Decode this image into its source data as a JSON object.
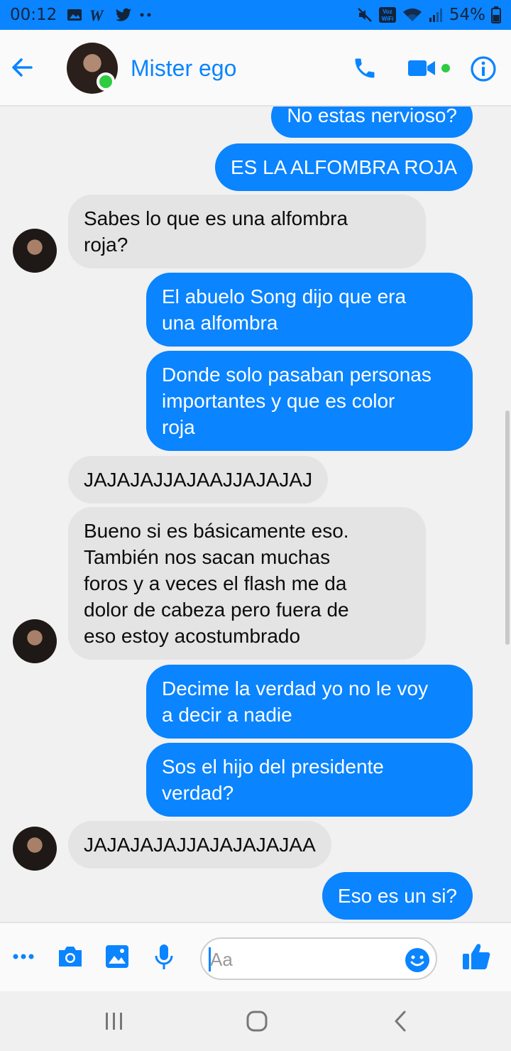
{
  "status_bar": {
    "time": "00:12",
    "battery": "54%",
    "left_icons": [
      "gallery-icon",
      "w-icon",
      "twitter-icon",
      "more-dots-icon"
    ],
    "right_icons": [
      "mute-icon",
      "voz-wifi-icon",
      "wifi-icon",
      "signal-icon",
      "battery-icon"
    ]
  },
  "header": {
    "contact_name": "Mister ego",
    "online": true,
    "accent": "#0a84ff"
  },
  "messages": [
    {
      "side": "out",
      "text": "No estas nervioso?"
    },
    {
      "side": "out",
      "text": "ES LA ALFOMBRA ROJA"
    },
    {
      "side": "in",
      "text": "Sabes lo que es una alfombra\nroja?"
    },
    {
      "side": "out",
      "text": "El abuelo Song dijo que era\nuna alfombra"
    },
    {
      "side": "out",
      "text": "Donde solo pasaban personas\nimportantes y que es color\nroja"
    },
    {
      "side": "in",
      "text": "JAJAJAJJAJAAJJAJAJAJ"
    },
    {
      "side": "in",
      "text": "Bueno si es básicamente eso.\nTambién nos sacan muchas\nforos y a veces el flash me da\ndolor de cabeza pero fuera de\neso estoy acostumbrado"
    },
    {
      "side": "out",
      "text": "Decime la verdad yo no le voy\na decir a nadie"
    },
    {
      "side": "out",
      "text": "Sos el hijo del presidente\nverdad?"
    },
    {
      "side": "in",
      "text": "JAJAJAJAJJAJAJAJAJAA"
    },
    {
      "side": "out",
      "text": "Eso es un si?"
    }
  ],
  "composer": {
    "placeholder": "Aa"
  },
  "colors": {
    "outgoing_bubble": "#0a84ff",
    "incoming_bubble": "#e4e4e4",
    "online_dot": "#2ecc40"
  }
}
